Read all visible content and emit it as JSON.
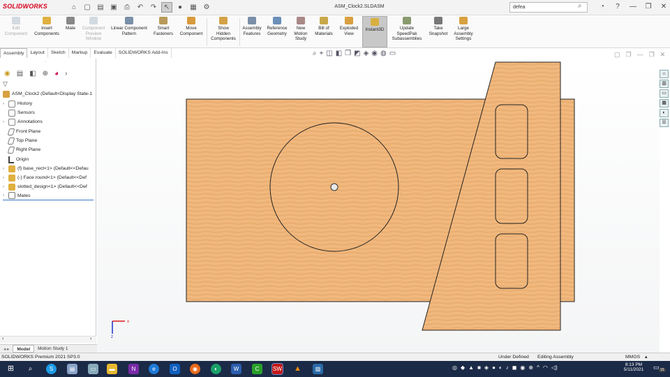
{
  "app": {
    "logo": "SOLIDWORKS",
    "doc_title": "ASM_Clock2.SLDASM",
    "search_value": "defea"
  },
  "ribbon": {
    "buttons": [
      {
        "label": "Edit\nComponent",
        "enabled": false
      },
      {
        "label": "Insert\nComponents",
        "enabled": true
      },
      {
        "label": "Mate",
        "enabled": true
      },
      {
        "label": "Component\nPreview\nWindow",
        "enabled": false
      },
      {
        "label": "Linear Component\nPattern",
        "enabled": true
      },
      {
        "label": "Smart\nFasteners",
        "enabled": true
      },
      {
        "label": "Move\nComponent",
        "enabled": true
      },
      {
        "label": "Show\nHidden\nComponents",
        "enabled": true
      },
      {
        "label": "Assembly\nFeatures",
        "enabled": true
      },
      {
        "label": "Reference\nGeometry",
        "enabled": true
      },
      {
        "label": "New\nMotion\nStudy",
        "enabled": true
      },
      {
        "label": "Bill of\nMaterials",
        "enabled": true
      },
      {
        "label": "Exploded\nView",
        "enabled": true
      },
      {
        "label": "Instant3D",
        "enabled": true
      },
      {
        "label": "Update\nSpeedPak\nSubassemblies",
        "enabled": true
      },
      {
        "label": "Take\nSnapshot",
        "enabled": true
      },
      {
        "label": "Large\nAssembly\nSettings",
        "enabled": true
      }
    ]
  },
  "tabs": [
    "Assembly",
    "Layout",
    "Sketch",
    "Markup",
    "Evaluate",
    "SOLIDWORKS Add-Ins"
  ],
  "tree": {
    "root": "ASM_Clock2  (Default<Display State-1",
    "items": [
      {
        "label": "History",
        "expandable": true
      },
      {
        "label": "Sensors",
        "expandable": false
      },
      {
        "label": "Annotations",
        "expandable": true
      },
      {
        "label": "Front Plane",
        "expandable": false
      },
      {
        "label": "Top Plane",
        "expandable": false
      },
      {
        "label": "Right Plane",
        "expandable": false
      },
      {
        "label": "Origin",
        "expandable": false
      },
      {
        "label": "(f) base_rect<1> (Default<<Defau",
        "expandable": true
      },
      {
        "label": "(-) Face round<1> (Default<<Def",
        "expandable": true
      },
      {
        "label": "slotted_design<1> (Default<<Def",
        "expandable": true
      },
      {
        "label": "Mates",
        "expandable": true
      }
    ]
  },
  "bottom_tabs": [
    "Model",
    "Motion Study 1"
  ],
  "status": {
    "left": "SOLIDWORKS Premium 2021 SP3.0",
    "state": "Under Defined",
    "mode": "Editing Assembly",
    "units": "MMGS"
  },
  "taskbar": {
    "time": "8:13 PM",
    "date": "5/11/2021",
    "notifications": "15"
  },
  "triad": {
    "x": "x",
    "z": "z"
  },
  "colors": {
    "wood": "#efb57a",
    "accent": "#d6001c",
    "taskbar": "#1b2a47"
  }
}
